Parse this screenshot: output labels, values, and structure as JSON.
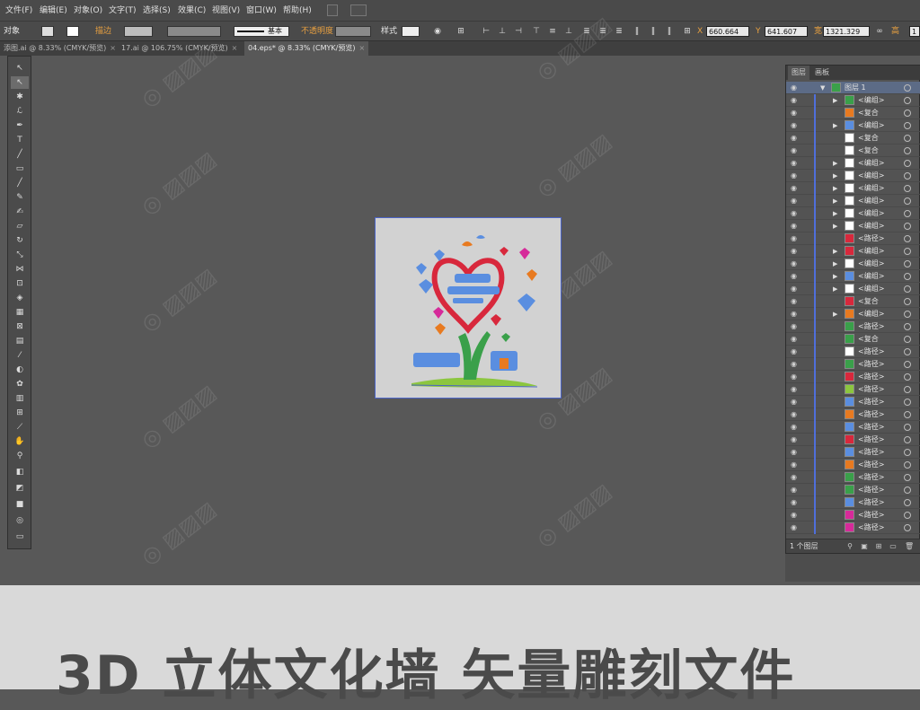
{
  "menubar": {
    "items": [
      "文件(F)",
      "编辑(E)",
      "对象(O)",
      "文字(T)",
      "选择(S)",
      "效果(C)",
      "视图(V)",
      "窗口(W)",
      "帮助(H)"
    ]
  },
  "control_bar": {
    "object_label": "对象",
    "stroke_label": "描边",
    "stroke_profile": "基本",
    "opacity_label": "不透明度",
    "style_label": "样式",
    "x_value": "660.664",
    "y_value": "641.607",
    "width_value": "1321.329",
    "x_label": "X",
    "y_label": "Y",
    "width_label": "宽",
    "height_label": "高",
    "height_value": "1"
  },
  "tabs": [
    {
      "label": "添图.ai @ 8.33% (CMYK/预览)",
      "active": false
    },
    {
      "label": "17.ai @ 106.75% (CMYK/预览)",
      "active": false
    },
    {
      "label": "04.eps* @ 8.33% (CMYK/预览)",
      "active": true
    }
  ],
  "tab_close": "×",
  "layers_panel": {
    "tabs": [
      "图层",
      "画板"
    ],
    "layer_name": "图层 1",
    "layer_count": "1 个图层",
    "rows": [
      {
        "name": "<编组>",
        "expand": true,
        "thumb": "#3aa04a"
      },
      {
        "name": "<复合",
        "expand": false,
        "thumb": "#e87a20"
      },
      {
        "name": "<编组>",
        "expand": true,
        "thumb": "#5a8ee0"
      },
      {
        "name": "<复合",
        "expand": false,
        "thumb": "#ffffff"
      },
      {
        "name": "<复合",
        "expand": false,
        "thumb": "#ffffff"
      },
      {
        "name": "<编组>",
        "expand": true,
        "thumb": "#ffffff"
      },
      {
        "name": "<编组>",
        "expand": true,
        "thumb": "#ffffff"
      },
      {
        "name": "<编组>",
        "expand": true,
        "thumb": "#ffffff"
      },
      {
        "name": "<编组>",
        "expand": true,
        "thumb": "#ffffff"
      },
      {
        "name": "<编组>",
        "expand": true,
        "thumb": "#ffffff"
      },
      {
        "name": "<编组>",
        "expand": true,
        "thumb": "#ffffff"
      },
      {
        "name": "<路径>",
        "expand": false,
        "thumb": "#d8283c"
      },
      {
        "name": "<编组>",
        "expand": true,
        "thumb": "#d8283c"
      },
      {
        "name": "<编组>",
        "expand": true,
        "thumb": "#ffffff"
      },
      {
        "name": "<编组>",
        "expand": true,
        "thumb": "#5a8ee0"
      },
      {
        "name": "<编组>",
        "expand": true,
        "thumb": "#ffffff"
      },
      {
        "name": "<复合",
        "expand": false,
        "thumb": "#d8283c"
      },
      {
        "name": "<编组>",
        "expand": true,
        "thumb": "#e87a20"
      },
      {
        "name": "<路径>",
        "expand": false,
        "thumb": "#3aa04a"
      },
      {
        "name": "<复合",
        "expand": false,
        "thumb": "#3aa04a"
      },
      {
        "name": "<路径>",
        "expand": false,
        "thumb": "#ffffff"
      },
      {
        "name": "<路径>",
        "expand": false,
        "thumb": "#3aa04a"
      },
      {
        "name": "<路径>",
        "expand": false,
        "thumb": "#d8283c"
      },
      {
        "name": "<路径>",
        "expand": false,
        "thumb": "#8cc63f"
      },
      {
        "name": "<路径>",
        "expand": false,
        "thumb": "#5a8ee0"
      },
      {
        "name": "<路径>",
        "expand": false,
        "thumb": "#e87a20"
      },
      {
        "name": "<路径>",
        "expand": false,
        "thumb": "#5a8ee0"
      },
      {
        "name": "<路径>",
        "expand": false,
        "thumb": "#d8283c"
      },
      {
        "name": "<路径>",
        "expand": false,
        "thumb": "#5a8ee0"
      },
      {
        "name": "<路径>",
        "expand": false,
        "thumb": "#e87a20"
      },
      {
        "name": "<路径>",
        "expand": false,
        "thumb": "#3aa04a"
      },
      {
        "name": "<路径>",
        "expand": false,
        "thumb": "#3aa04a"
      },
      {
        "name": "<路径>",
        "expand": false,
        "thumb": "#5a8ee0"
      },
      {
        "name": "<路径>",
        "expand": false,
        "thumb": "#d62a9a"
      },
      {
        "name": "<路径>",
        "expand": false,
        "thumb": "#d62a9a"
      },
      {
        "name": "<路径>",
        "expand": false,
        "thumb": "#e87a20"
      }
    ]
  },
  "banner": {
    "caption": "3D 立体文化墙 矢量雕刻文件"
  },
  "colors": {
    "artboard_border": "#4b64c8",
    "heart_red": "#d8283c",
    "tree_green": "#3aa04a",
    "blue": "#5a8ee0",
    "orange": "#e87a20"
  }
}
